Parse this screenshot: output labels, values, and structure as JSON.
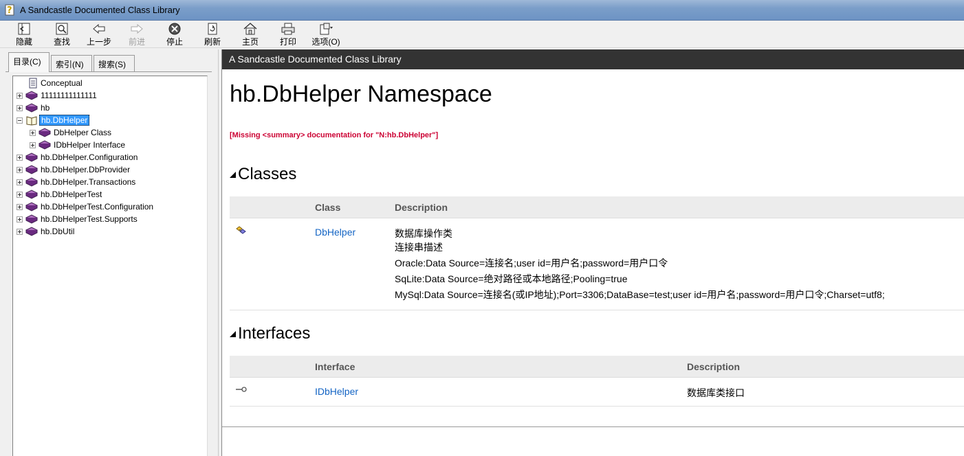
{
  "window": {
    "title": "A Sandcastle Documented Class Library"
  },
  "toolbar": {
    "hide": "隐藏",
    "find": "查找",
    "back": "上一步",
    "forward": "前进",
    "stop": "停止",
    "refresh": "刷新",
    "home": "主页",
    "print": "打印",
    "options": "选项(O)"
  },
  "tabs": [
    {
      "label": "目录(C)"
    },
    {
      "label": "索引(N)"
    },
    {
      "label": "搜索(S)"
    }
  ],
  "tree": [
    {
      "label": "Conceptual"
    },
    {
      "label": "11111111111111"
    },
    {
      "label": "hb"
    },
    {
      "label": "hb.DbHelper"
    },
    {
      "label": "DbHelper Class"
    },
    {
      "label": "IDbHelper Interface"
    },
    {
      "label": "hb.DbHelper.Configuration"
    },
    {
      "label": "hb.DbHelper.DbProvider"
    },
    {
      "label": "hb.DbHelper.Transactions"
    },
    {
      "label": "hb.DbHelperTest"
    },
    {
      "label": "hb.DbHelperTest.Configuration"
    },
    {
      "label": "hb.DbHelperTest.Supports"
    },
    {
      "label": "hb.DbUtil"
    }
  ],
  "content": {
    "header": "A Sandcastle Documented Class Library",
    "title": "hb.DbHelper Namespace",
    "missing": "[Missing <summary> documentation for \"N:hb.DbHelper\"]",
    "classes": {
      "title": "Classes",
      "col_class": "Class",
      "col_desc": "Description",
      "rows": [
        {
          "name": "DbHelper",
          "desc": [
            "数据库操作类",
            "连接串描述",
            "Oracle:Data Source=连接名;user id=用户名;password=用户口令",
            "SqLite:Data Source=绝对路径或本地路径;Pooling=true",
            "MySql:Data Source=连接名(或IP地址);Port=3306;DataBase=test;user id=用户名;password=用户口令;Charset=utf8;"
          ]
        }
      ]
    },
    "interfaces": {
      "title": "Interfaces",
      "col_interface": "Interface",
      "col_desc": "Description",
      "rows": [
        {
          "name": "IDbHelper",
          "desc": "数据库类接口"
        }
      ]
    }
  }
}
